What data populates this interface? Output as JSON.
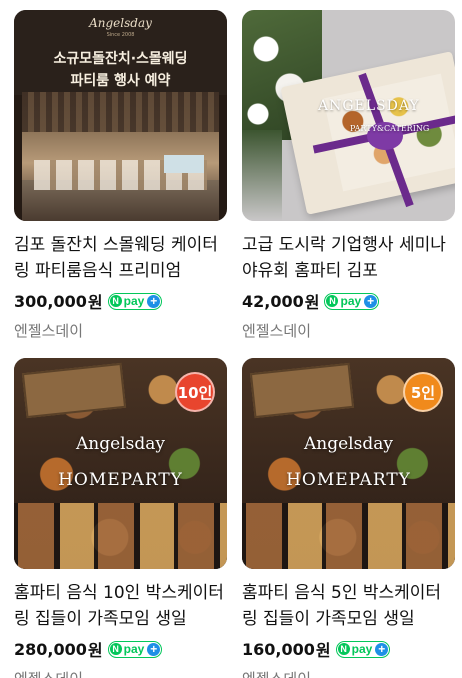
{
  "colors": {
    "npay_green": "#03c75a",
    "npay_plus_blue": "#1e90e6",
    "badge_10": "#e8452e",
    "badge_5": "#f08a1c",
    "seller_gray": "#777777"
  },
  "products": [
    {
      "image": {
        "icon": "banquet-hall-photo",
        "logo_text": "Angelsday",
        "sub_text": "Since 2008",
        "headline_1": "소규모돌잔치·스몰웨딩",
        "headline_2": "파티룸 행사 예약"
      },
      "title": "김포 돌잔치 스몰웨딩 케이터링 파티룸음식 프리미엄",
      "price": "300,000",
      "currency": "원",
      "npay_label": "pay",
      "seller": "엔젤스데이"
    },
    {
      "image": {
        "icon": "catering-box-photo",
        "line_1": "ANGELSDAY",
        "line_2": "PARTY&CATERING"
      },
      "title": "고급 도시락 기업행사 세미나 야유회 홈파티 김포",
      "price": "42,000",
      "currency": "원",
      "npay_label": "pay",
      "seller": "엔젤스데이"
    },
    {
      "image": {
        "icon": "homeparty-food-photo",
        "line_1": "Angelsday",
        "line_2": "HOMEPARTY",
        "badge": "10인"
      },
      "title": "홈파티 음식 10인 박스케이터링 집들이 가족모임 생일",
      "price": "280,000",
      "currency": "원",
      "npay_label": "pay",
      "seller": "엔젤스데이"
    },
    {
      "image": {
        "icon": "homeparty-food-photo",
        "line_1": "Angelsday",
        "line_2": "HOMEPARTY",
        "badge": "5인"
      },
      "title": "홈파티 음식 5인 박스케이터링 집들이 가족모임 생일",
      "price": "160,000",
      "currency": "원",
      "npay_label": "pay",
      "seller": "엔젤스데이"
    }
  ]
}
